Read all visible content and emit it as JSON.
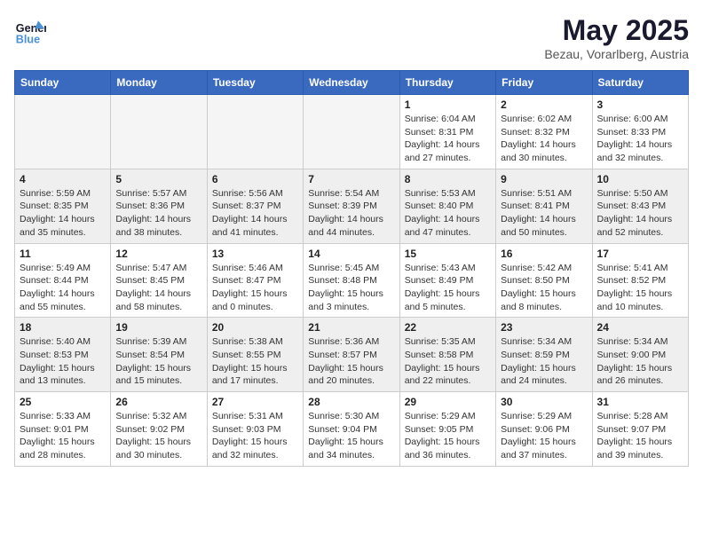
{
  "logo": {
    "text_general": "General",
    "text_blue": "Blue"
  },
  "title": "May 2025",
  "subtitle": "Bezau, Vorarlberg, Austria",
  "weekdays": [
    "Sunday",
    "Monday",
    "Tuesday",
    "Wednesday",
    "Thursday",
    "Friday",
    "Saturday"
  ],
  "weeks": [
    [
      {
        "day": "",
        "info": ""
      },
      {
        "day": "",
        "info": ""
      },
      {
        "day": "",
        "info": ""
      },
      {
        "day": "",
        "info": ""
      },
      {
        "day": "1",
        "info": "Sunrise: 6:04 AM\nSunset: 8:31 PM\nDaylight: 14 hours\nand 27 minutes."
      },
      {
        "day": "2",
        "info": "Sunrise: 6:02 AM\nSunset: 8:32 PM\nDaylight: 14 hours\nand 30 minutes."
      },
      {
        "day": "3",
        "info": "Sunrise: 6:00 AM\nSunset: 8:33 PM\nDaylight: 14 hours\nand 32 minutes."
      }
    ],
    [
      {
        "day": "4",
        "info": "Sunrise: 5:59 AM\nSunset: 8:35 PM\nDaylight: 14 hours\nand 35 minutes."
      },
      {
        "day": "5",
        "info": "Sunrise: 5:57 AM\nSunset: 8:36 PM\nDaylight: 14 hours\nand 38 minutes."
      },
      {
        "day": "6",
        "info": "Sunrise: 5:56 AM\nSunset: 8:37 PM\nDaylight: 14 hours\nand 41 minutes."
      },
      {
        "day": "7",
        "info": "Sunrise: 5:54 AM\nSunset: 8:39 PM\nDaylight: 14 hours\nand 44 minutes."
      },
      {
        "day": "8",
        "info": "Sunrise: 5:53 AM\nSunset: 8:40 PM\nDaylight: 14 hours\nand 47 minutes."
      },
      {
        "day": "9",
        "info": "Sunrise: 5:51 AM\nSunset: 8:41 PM\nDaylight: 14 hours\nand 50 minutes."
      },
      {
        "day": "10",
        "info": "Sunrise: 5:50 AM\nSunset: 8:43 PM\nDaylight: 14 hours\nand 52 minutes."
      }
    ],
    [
      {
        "day": "11",
        "info": "Sunrise: 5:49 AM\nSunset: 8:44 PM\nDaylight: 14 hours\nand 55 minutes."
      },
      {
        "day": "12",
        "info": "Sunrise: 5:47 AM\nSunset: 8:45 PM\nDaylight: 14 hours\nand 58 minutes."
      },
      {
        "day": "13",
        "info": "Sunrise: 5:46 AM\nSunset: 8:47 PM\nDaylight: 15 hours\nand 0 minutes."
      },
      {
        "day": "14",
        "info": "Sunrise: 5:45 AM\nSunset: 8:48 PM\nDaylight: 15 hours\nand 3 minutes."
      },
      {
        "day": "15",
        "info": "Sunrise: 5:43 AM\nSunset: 8:49 PM\nDaylight: 15 hours\nand 5 minutes."
      },
      {
        "day": "16",
        "info": "Sunrise: 5:42 AM\nSunset: 8:50 PM\nDaylight: 15 hours\nand 8 minutes."
      },
      {
        "day": "17",
        "info": "Sunrise: 5:41 AM\nSunset: 8:52 PM\nDaylight: 15 hours\nand 10 minutes."
      }
    ],
    [
      {
        "day": "18",
        "info": "Sunrise: 5:40 AM\nSunset: 8:53 PM\nDaylight: 15 hours\nand 13 minutes."
      },
      {
        "day": "19",
        "info": "Sunrise: 5:39 AM\nSunset: 8:54 PM\nDaylight: 15 hours\nand 15 minutes."
      },
      {
        "day": "20",
        "info": "Sunrise: 5:38 AM\nSunset: 8:55 PM\nDaylight: 15 hours\nand 17 minutes."
      },
      {
        "day": "21",
        "info": "Sunrise: 5:36 AM\nSunset: 8:57 PM\nDaylight: 15 hours\nand 20 minutes."
      },
      {
        "day": "22",
        "info": "Sunrise: 5:35 AM\nSunset: 8:58 PM\nDaylight: 15 hours\nand 22 minutes."
      },
      {
        "day": "23",
        "info": "Sunrise: 5:34 AM\nSunset: 8:59 PM\nDaylight: 15 hours\nand 24 minutes."
      },
      {
        "day": "24",
        "info": "Sunrise: 5:34 AM\nSunset: 9:00 PM\nDaylight: 15 hours\nand 26 minutes."
      }
    ],
    [
      {
        "day": "25",
        "info": "Sunrise: 5:33 AM\nSunset: 9:01 PM\nDaylight: 15 hours\nand 28 minutes."
      },
      {
        "day": "26",
        "info": "Sunrise: 5:32 AM\nSunset: 9:02 PM\nDaylight: 15 hours\nand 30 minutes."
      },
      {
        "day": "27",
        "info": "Sunrise: 5:31 AM\nSunset: 9:03 PM\nDaylight: 15 hours\nand 32 minutes."
      },
      {
        "day": "28",
        "info": "Sunrise: 5:30 AM\nSunset: 9:04 PM\nDaylight: 15 hours\nand 34 minutes."
      },
      {
        "day": "29",
        "info": "Sunrise: 5:29 AM\nSunset: 9:05 PM\nDaylight: 15 hours\nand 36 minutes."
      },
      {
        "day": "30",
        "info": "Sunrise: 5:29 AM\nSunset: 9:06 PM\nDaylight: 15 hours\nand 37 minutes."
      },
      {
        "day": "31",
        "info": "Sunrise: 5:28 AM\nSunset: 9:07 PM\nDaylight: 15 hours\nand 39 minutes."
      }
    ]
  ]
}
